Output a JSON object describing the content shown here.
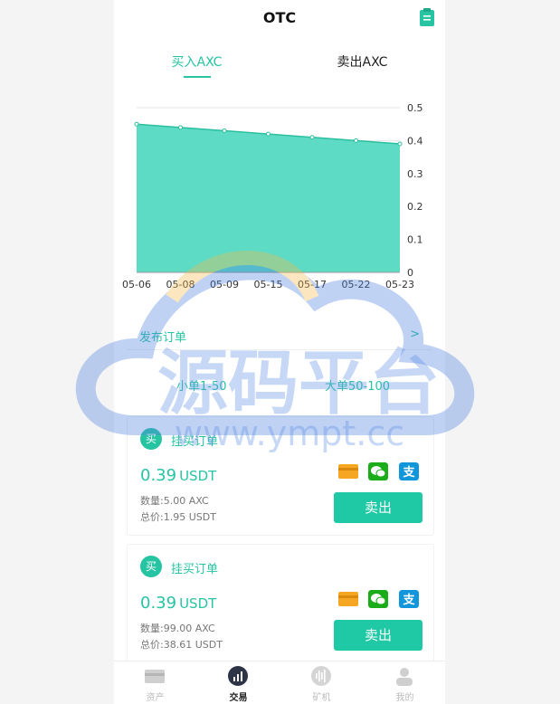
{
  "header": {
    "title": "OTC"
  },
  "tabs": [
    {
      "label": "买入AXC"
    },
    {
      "label": "卖出AXC"
    }
  ],
  "chart_data": {
    "type": "area",
    "categories": [
      "05-06",
      "05-08",
      "05-09",
      "05-15",
      "05-17",
      "05-22",
      "05-23"
    ],
    "values": [
      0.45,
      0.44,
      0.43,
      0.42,
      0.41,
      0.4,
      0.39
    ],
    "ylim": [
      0,
      0.5
    ],
    "yticks": [
      "0",
      "0.1",
      "0.2",
      "0.3",
      "0.4",
      "0.5"
    ],
    "grid": true,
    "fill_color": "#5ddbc4",
    "line_color": "#2bbf9f"
  },
  "publish": {
    "label": "发布订单",
    "arrow": ">"
  },
  "size_tabs": [
    {
      "label": "小单1-50"
    },
    {
      "label": "大单50-100"
    }
  ],
  "orders": [
    {
      "badge": "买",
      "title": "挂买订单",
      "price": "0.39",
      "unit": "USDT",
      "qty": "数量:5.00 AXC",
      "total": "总价:1.95 USDT",
      "button": "卖出"
    },
    {
      "badge": "买",
      "title": "挂买订单",
      "price": "0.39",
      "unit": "USDT",
      "qty": "数量:99.00 AXC",
      "total": "总价:38.61 USDT",
      "button": "卖出"
    }
  ],
  "nav": [
    {
      "label": "资产",
      "icon": "wallet-icon"
    },
    {
      "label": "交易",
      "icon": "trade-chart-icon"
    },
    {
      "label": "矿机",
      "icon": "miner-icon"
    },
    {
      "label": "我的",
      "icon": "user-icon"
    }
  ],
  "watermark": {
    "brand": "源码平台",
    "url": "www.ympt.cc"
  },
  "colors": {
    "accent": "#27c4a3",
    "button": "#20c9a6"
  }
}
